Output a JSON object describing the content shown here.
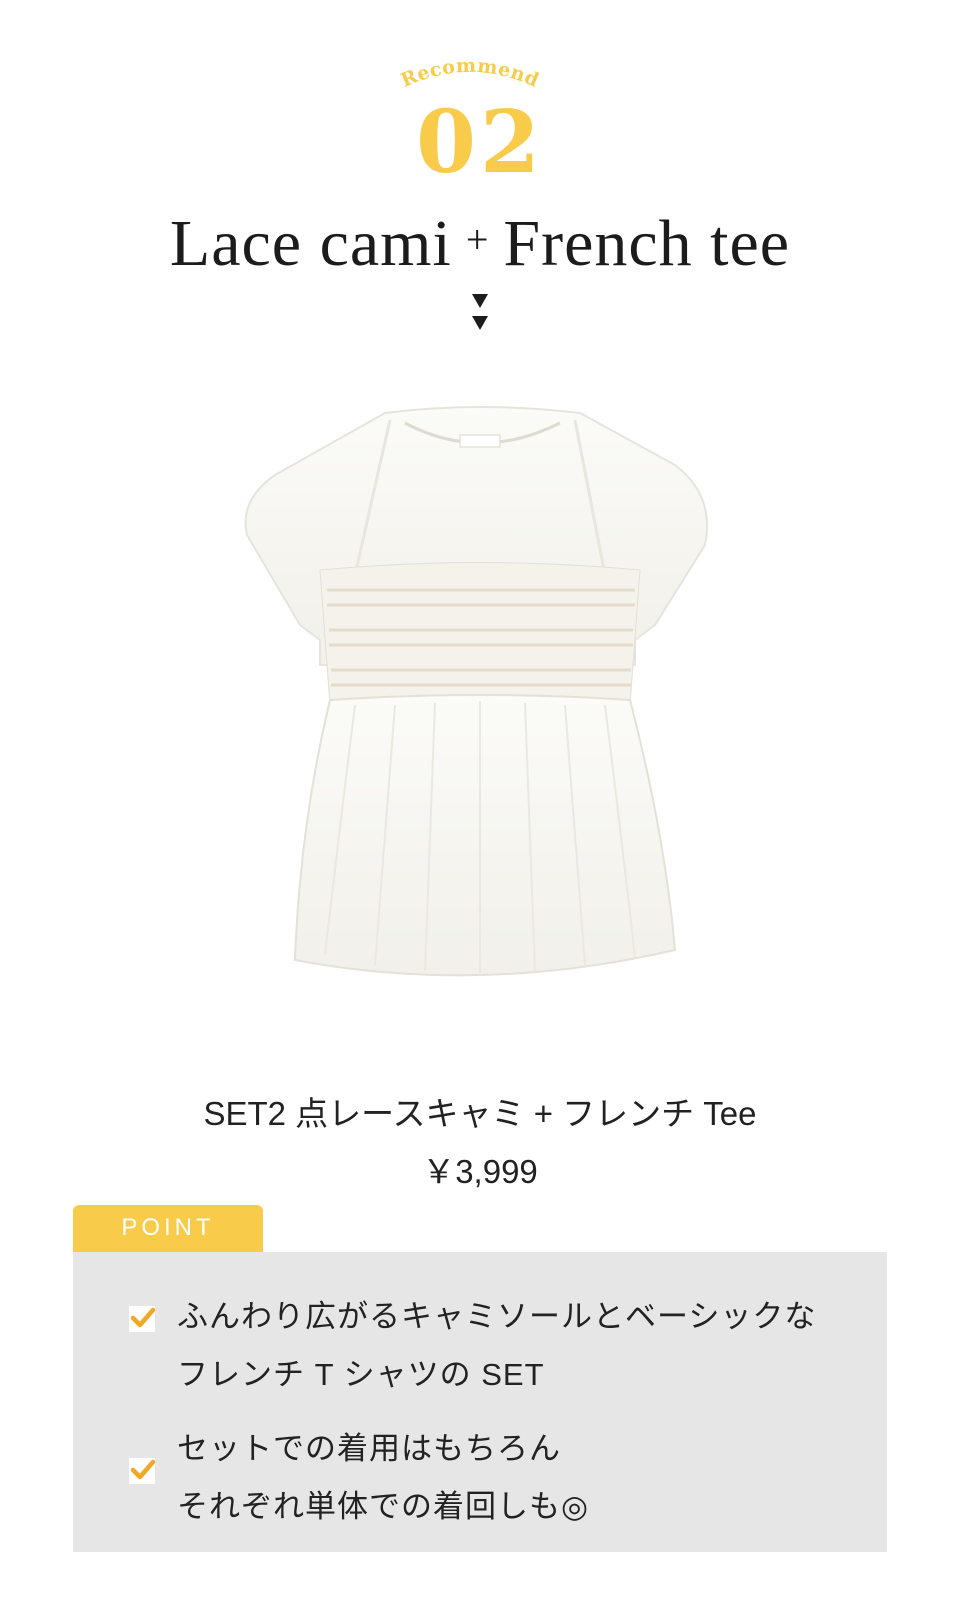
{
  "colors": {
    "accent": "#f8cc4a",
    "panel": "#e6e6e6",
    "text": "#1c1c1c"
  },
  "header": {
    "kicker": "Recommend",
    "number": "02",
    "title_left": "Lace cami",
    "title_plus": "+",
    "title_right": "French tee"
  },
  "product": {
    "name": "SET2 点レースキャミ + フレンチ Tee",
    "price": "￥3,999"
  },
  "point": {
    "label": "POINT",
    "items": [
      {
        "icon": "check-icon",
        "lines": [
          "ふんわり広がるキャミソールとベーシックな",
          "フレンチ T シャツの SET"
        ]
      },
      {
        "icon": "check-icon",
        "lines": [
          "セットでの着用はもちろん",
          "それぞれ単体での着回しも◎"
        ]
      }
    ]
  }
}
